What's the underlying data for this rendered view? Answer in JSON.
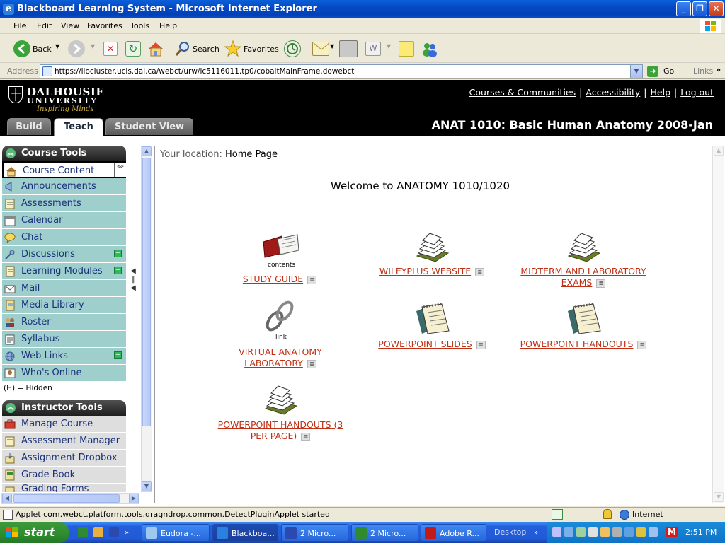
{
  "window": {
    "title": "Blackboard Learning System - Microsoft Internet Explorer",
    "min": "_",
    "max": "❐",
    "close": "✕"
  },
  "menu": [
    "File",
    "Edit",
    "View",
    "Favorites",
    "Tools",
    "Help"
  ],
  "toolbar": {
    "back": "Back",
    "search": "Search",
    "favorites": "Favorites"
  },
  "address": {
    "label": "Address",
    "url": "https://ilocluster.ucis.dal.ca/webct/urw/lc5116011.tp0/cobaltMainFrame.dowebct",
    "go": "Go",
    "links": "Links"
  },
  "header": {
    "logo_name": "DALHOUSIE",
    "logo_sub": "UNIVERSITY",
    "logo_tagline": "Inspiring Minds",
    "links": [
      "Courses & Communities",
      "Accessibility",
      "Help",
      "Log out"
    ],
    "course_title": "ANAT 1010: Basic Human Anatomy 2008-Jan",
    "tabs": [
      "Build",
      "Teach",
      "Student View"
    ]
  },
  "course_tools": {
    "title": "Course Tools",
    "items": [
      {
        "label": "Course Content"
      },
      {
        "label": "Announcements"
      },
      {
        "label": "Assessments"
      },
      {
        "label": "Calendar"
      },
      {
        "label": "Chat"
      },
      {
        "label": "Discussions",
        "new": true
      },
      {
        "label": "Learning Modules",
        "new": true
      },
      {
        "label": "Mail"
      },
      {
        "label": "Media Library"
      },
      {
        "label": "Roster"
      },
      {
        "label": "Syllabus"
      },
      {
        "label": "Web Links",
        "new": true
      },
      {
        "label": "Who's Online"
      }
    ],
    "hidden_note": "(H) = Hidden"
  },
  "instructor_tools": {
    "title": "Instructor Tools",
    "items": [
      {
        "label": "Manage Course"
      },
      {
        "label": "Assessment Manager"
      },
      {
        "label": "Assignment Dropbox"
      },
      {
        "label": "Grade Book"
      },
      {
        "label": "Grading Forms"
      }
    ]
  },
  "main": {
    "location_label": "Your location:",
    "location_value": "Home Page",
    "welcome": "Welcome to ANATOMY 1010/1020",
    "items": [
      {
        "line1": "STUDY GUIDE",
        "line2": "",
        "caption": "contents",
        "icon": "book-icon"
      },
      {
        "line1": "WILEYPLUS WEBSITE",
        "line2": "",
        "caption": "",
        "icon": "stack-of-papers-icon"
      },
      {
        "line1": "MIDTERM AND LABORATORY",
        "line2": "EXAMS",
        "caption": "",
        "icon": "stack-of-papers-icon"
      },
      {
        "line1": "VIRTUAL ANATOMY",
        "line2": "LABORATORY",
        "caption": "link",
        "icon": "chain-link-icon"
      },
      {
        "line1": "POWERPOINT SLIDES",
        "line2": "",
        "caption": "",
        "icon": "notepad-icon"
      },
      {
        "line1": "POWERPOINT HANDOUTS",
        "line2": "",
        "caption": "",
        "icon": "notepad-icon"
      },
      {
        "line1": "POWERPOINT HANDOUTS (3",
        "line2": "PER PAGE)",
        "caption": "",
        "icon": "stack-of-papers-icon"
      }
    ]
  },
  "status": {
    "text": "Applet com.webct.platform.tools.dragndrop.common.DetectPluginApplet started",
    "zone": "Internet"
  },
  "taskbar": {
    "start": "start",
    "tasks": [
      "Eudora -...",
      "Blackboa...",
      "2 Micro...",
      "2 Micro...",
      "Adobe R..."
    ],
    "desktop": "Desktop",
    "clock": "2:51 PM"
  },
  "colors": {
    "link": "#c03014",
    "nav_bg": "#9fcfcd",
    "nav_text": "#19317a",
    "header_bg": "#000000"
  }
}
